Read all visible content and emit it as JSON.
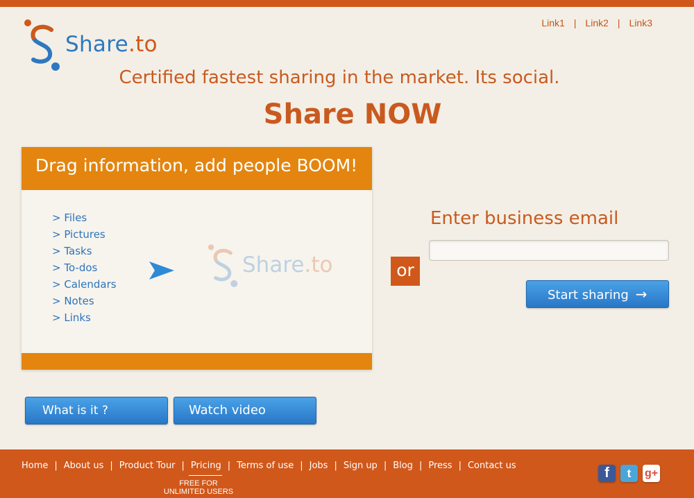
{
  "brand": {
    "name_main": "Share",
    "name_suffix": ".to",
    "colors": {
      "primary_orange": "#d0581a",
      "panel_orange": "#e3850f",
      "brand_blue": "#2e78bf",
      "background": "#f3efe6"
    }
  },
  "top_links": [
    "Link1",
    "Link2",
    "Link3"
  ],
  "hero": {
    "tagline": "Certified fastest sharing in the market. Its social.",
    "headline": "Share NOW"
  },
  "panel": {
    "title": "Drag information, add people BOOM!",
    "items": [
      "> Files",
      "> Pictures",
      "> Tasks",
      "> To-dos",
      "> Calendars",
      "> Notes",
      "> Links"
    ],
    "arrow_icon": "play-arrow-icon",
    "watermark_main": "Share",
    "watermark_suffix": ".to"
  },
  "or_label": "or",
  "signup": {
    "label": "Enter business email",
    "email_value": "",
    "button_label": "Start sharing",
    "button_icon": "→"
  },
  "buttons": {
    "what_is_it": "What is it ?",
    "watch_video": "Watch video"
  },
  "footer": {
    "nav": [
      "Home",
      "About us",
      "Product Tour",
      "Pricing",
      "Terms of use",
      "Jobs",
      "Sign up",
      "Blog",
      "Press",
      "Contact us"
    ],
    "free_note_line1": "FREE FOR",
    "free_note_line2": "UNLIMITED USERS",
    "social": {
      "facebook": "f",
      "twitter": "t",
      "google_g": "g",
      "google_plus": "+"
    }
  }
}
